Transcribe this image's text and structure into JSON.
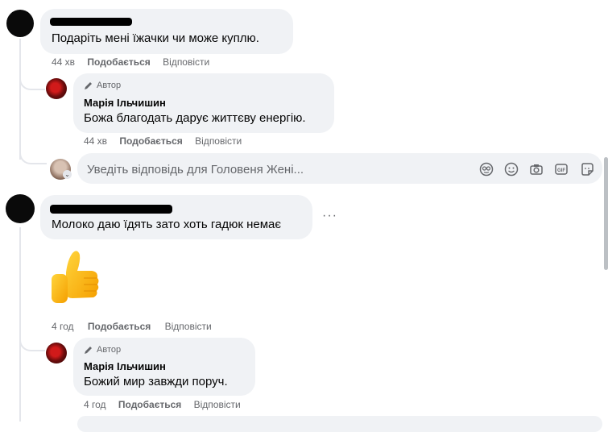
{
  "comments": [
    {
      "text": "Подаріть мені їжачки чи може куплю.",
      "time": "44 хв",
      "like": "Подобається",
      "reply": "Відповісти",
      "reply_item": {
        "badge": "Автор",
        "name": "Марія Ільчишин",
        "text": "Божа благодать дарує життєву енергію.",
        "time": "44 хв",
        "like": "Подобається",
        "reply": "Відповісти"
      }
    },
    {
      "text": "Молоко даю їдять зато хоть гадюк немає",
      "more": "···",
      "time": "4 год",
      "like": "Подобається",
      "reply": "Відповісти",
      "reply_item": {
        "badge": "Автор",
        "name": "Марія Ільчишин",
        "text": "Божий мир завжди поруч.",
        "time": "4 год",
        "like": "Подобається",
        "reply": "Відповісти"
      }
    }
  ],
  "reply_input": {
    "placeholder": "Уведіть відповідь для Головеня Жені...",
    "icons": [
      "avatar-icon",
      "emoji-icon",
      "camera-icon",
      "gif-icon",
      "sticker-icon"
    ]
  },
  "colors": {
    "bubble": "#f0f2f5",
    "meta": "#65676b",
    "line": "#e4e6eb"
  }
}
